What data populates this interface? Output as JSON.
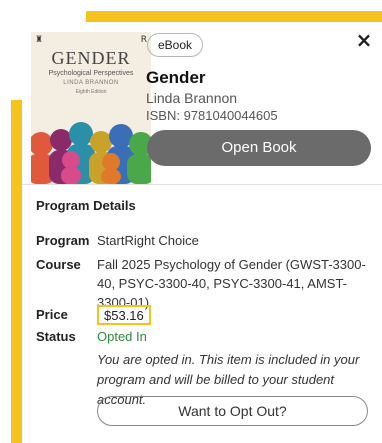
{
  "book": {
    "format_badge": "eBook",
    "title": "Gender",
    "author": "Linda Brannon",
    "isbn": "ISBN: 9781040044605",
    "open_label": "Open Book",
    "cover": {
      "title": "GENDER",
      "subtitle": "Psychological Perspectives",
      "author": "LINDA BRANNON",
      "edition": "Eighth Edition"
    }
  },
  "close_symbol": "×",
  "program": {
    "section_title": "Program Details",
    "program_label": "Program",
    "program_value": "StartRight Choice",
    "course_label": "Course",
    "course_value": "Fall 2025 Psychology of Gender (GWST-3300-40, PSYC-3300-40, PSYC-3300-41, AMST-3300-01)",
    "price_label": "Price",
    "price_value": "$53.16",
    "status_label": "Status",
    "status_value": "Opted In",
    "note": "You are opted in. This item is included in your program and will be billed to your student account.",
    "opt_out_label": "Want to Opt Out?"
  },
  "colors": {
    "accent": "#f6c21c",
    "status_green": "#2e8b3d",
    "button_gray": "#6b6b6b"
  }
}
